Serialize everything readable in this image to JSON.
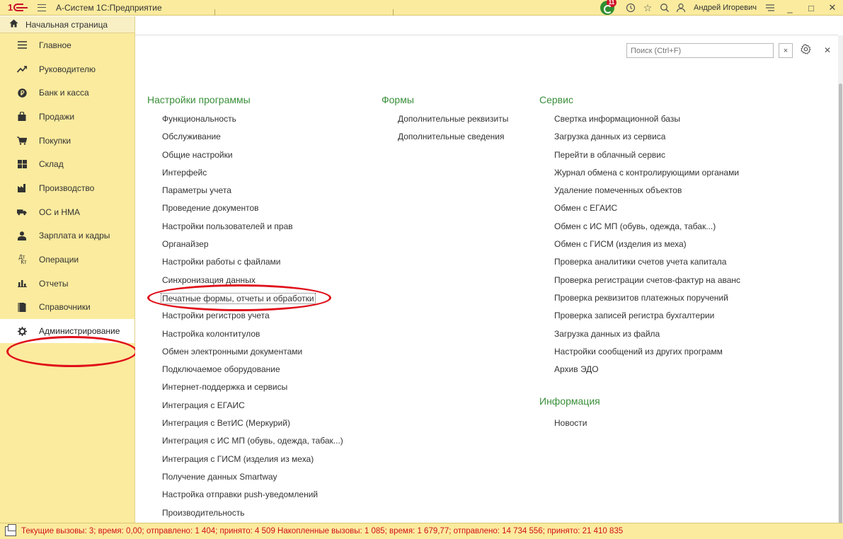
{
  "app": {
    "title": "А-Систем 1С:Предприятие",
    "user": "Андрей Игоревич",
    "notification_count": "11"
  },
  "colors": {
    "panel": "#fbeb9e",
    "section_title": "#3a8f3a",
    "status_text": "#d0101a",
    "highlight_ring": "#e0101a"
  },
  "sidebar": {
    "home": "Начальная страница",
    "items": [
      {
        "label": "Главное",
        "icon": "menu-lines-icon"
      },
      {
        "label": "Руководителю",
        "icon": "trend-chart-icon"
      },
      {
        "label": "Банк и касса",
        "icon": "ruble-coin-icon"
      },
      {
        "label": "Продажи",
        "icon": "shopping-bag-icon"
      },
      {
        "label": "Покупки",
        "icon": "cart-icon"
      },
      {
        "label": "Склад",
        "icon": "warehouse-icon"
      },
      {
        "label": "Производство",
        "icon": "factory-icon"
      },
      {
        "label": "ОС и НМА",
        "icon": "truck-icon"
      },
      {
        "label": "Зарплата и кадры",
        "icon": "person-icon"
      },
      {
        "label": "Операции",
        "icon": "debit-credit-icon"
      },
      {
        "label": "Отчеты",
        "icon": "bar-chart-icon"
      },
      {
        "label": "Справочники",
        "icon": "book-icon"
      },
      {
        "label": "Администрирование",
        "icon": "gear-icon"
      }
    ]
  },
  "search": {
    "placeholder": "Поиск (Ctrl+F)",
    "clear": "×"
  },
  "sections": {
    "settings": {
      "title": "Настройки программы",
      "items": [
        "Функциональность",
        "Обслуживание",
        "Общие настройки",
        "Интерфейс",
        "Параметры учета",
        "Проведение документов",
        "Настройки пользователей и прав",
        "Органайзер",
        "Настройки работы с файлами",
        "Синхронизация данных",
        "Печатные формы, отчеты и обработки",
        "Настройки регистров учета",
        "Настройка колонтитулов",
        "Обмен электронными документами",
        "Подключаемое оборудование",
        "Интернет-поддержка и сервисы",
        "Интеграция с ЕГАИС",
        "Интеграция с ВетИС (Меркурий)",
        "Интеграция с ИС МП (обувь, одежда, табак...)",
        "Интеграция с ГИСМ (изделия из меха)",
        "Получение данных Smartway",
        "Настройка отправки push-уведомлений",
        "Производительность"
      ]
    },
    "forms": {
      "title": "Формы",
      "items": [
        "Дополнительные реквизиты",
        "Дополнительные сведения"
      ]
    },
    "service": {
      "title": "Сервис",
      "items": [
        "Свертка информационной базы",
        "Загрузка данных из сервиса",
        "Перейти в облачный сервис",
        "Журнал обмена с контролирующими органами",
        "Удаление помеченных объектов",
        "Обмен с ЕГАИС",
        "Обмен с ИС МП (обувь, одежда, табак...)",
        "Обмен с ГИСМ (изделия из меха)",
        "Проверка аналитики счетов учета капитала",
        "Проверка регистрации счетов-фактур на аванс",
        "Проверка реквизитов платежных поручений",
        "Проверка записей регистра бухгалтерии",
        "Загрузка данных из файла",
        "Настройки сообщений из других программ",
        "Архив ЭДО"
      ]
    },
    "info": {
      "title": "Информация",
      "items": [
        "Новости"
      ]
    }
  },
  "status": {
    "text": "Текущие вызовы: 3; время: 0,00; отправлено: 1 404; принято: 4 509   Накопленные вызовы: 1 085; время: 1 679,77; отправлено: 14 734 556; принято: 21 410 835"
  }
}
